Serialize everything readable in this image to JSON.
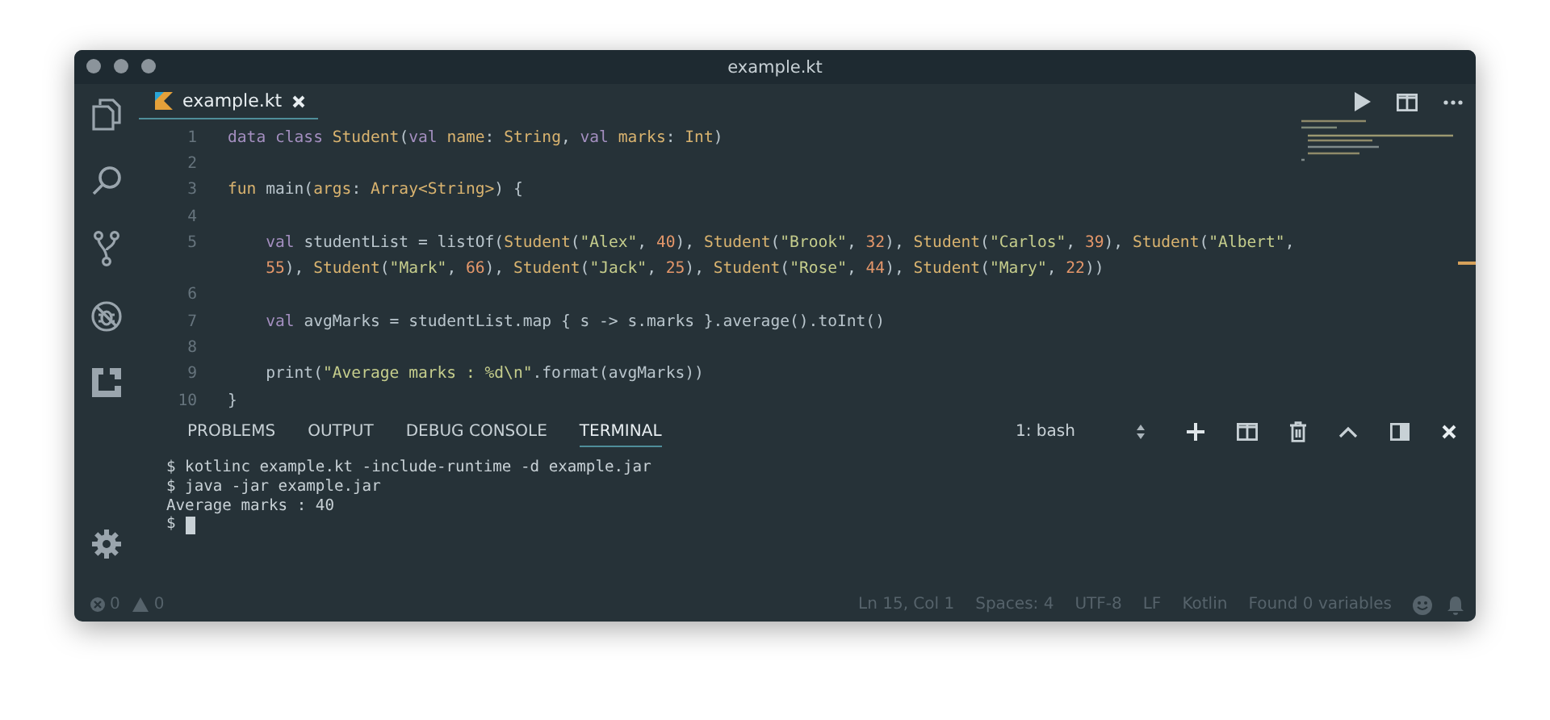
{
  "window": {
    "title": "example.kt"
  },
  "editor_tabs": [
    {
      "label": "example.kt",
      "selected": true
    }
  ],
  "code_lines": [
    {
      "number": "1",
      "tokens": [
        {
          "kind": "kw",
          "text": "data class "
        },
        {
          "kind": "type",
          "text": "Student"
        },
        {
          "kind": "plain",
          "text": "("
        },
        {
          "kind": "kw",
          "text": "val "
        },
        {
          "kind": "type",
          "text": "name"
        },
        {
          "kind": "plain",
          "text": ": "
        },
        {
          "kind": "type",
          "text": "String"
        },
        {
          "kind": "plain",
          "text": ", "
        },
        {
          "kind": "kw",
          "text": "val "
        },
        {
          "kind": "type",
          "text": "marks"
        },
        {
          "kind": "plain",
          "text": ": "
        },
        {
          "kind": "type",
          "text": "Int"
        },
        {
          "kind": "plain",
          "text": ")"
        }
      ]
    },
    {
      "number": "2"
    },
    {
      "number": "3",
      "tokens": [
        {
          "kind": "type",
          "text": "fun "
        },
        {
          "kind": "plain",
          "text": "main("
        },
        {
          "kind": "type",
          "text": "args"
        },
        {
          "kind": "plain",
          "text": ": "
        },
        {
          "kind": "type",
          "text": "Array<String>"
        },
        {
          "kind": "plain",
          "text": ") {"
        }
      ]
    },
    {
      "number": "4"
    },
    {
      "number": "5",
      "tokens": [
        {
          "kind": "kw",
          "text": "    val "
        },
        {
          "kind": "plain",
          "text": "studentList = listOf("
        },
        {
          "kind": "type",
          "text": "Student"
        },
        {
          "kind": "plain",
          "text": "("
        },
        {
          "kind": "str",
          "text": "\"Alex\""
        },
        {
          "kind": "plain",
          "text": ", "
        },
        {
          "kind": "num",
          "text": "40"
        },
        {
          "kind": "plain",
          "text": "), "
        },
        {
          "kind": "type",
          "text": "Student"
        },
        {
          "kind": "plain",
          "text": "("
        },
        {
          "kind": "str",
          "text": "\"Brook\""
        },
        {
          "kind": "plain",
          "text": ", "
        },
        {
          "kind": "num",
          "text": "32"
        },
        {
          "kind": "plain",
          "text": "), "
        },
        {
          "kind": "type",
          "text": "Student"
        },
        {
          "kind": "plain",
          "text": "("
        },
        {
          "kind": "str",
          "text": "\"Carlos\""
        },
        {
          "kind": "plain",
          "text": ", "
        },
        {
          "kind": "num",
          "text": "39"
        },
        {
          "kind": "plain",
          "text": "), "
        },
        {
          "kind": "type",
          "text": "Student"
        },
        {
          "kind": "plain",
          "text": "("
        },
        {
          "kind": "str",
          "text": "\"Albert\""
        },
        {
          "kind": "plain",
          "text": ","
        }
      ]
    },
    {
      "tokens": [
        {
          "kind": "num",
          "text": "    55"
        },
        {
          "kind": "plain",
          "text": "), "
        },
        {
          "kind": "type",
          "text": "Student"
        },
        {
          "kind": "plain",
          "text": "("
        },
        {
          "kind": "str",
          "text": "\"Mark\""
        },
        {
          "kind": "plain",
          "text": ", "
        },
        {
          "kind": "num",
          "text": "66"
        },
        {
          "kind": "plain",
          "text": "), "
        },
        {
          "kind": "type",
          "text": "Student"
        },
        {
          "kind": "plain",
          "text": "("
        },
        {
          "kind": "str",
          "text": "\"Jack\""
        },
        {
          "kind": "plain",
          "text": ", "
        },
        {
          "kind": "num",
          "text": "25"
        },
        {
          "kind": "plain",
          "text": "), "
        },
        {
          "kind": "type",
          "text": "Student"
        },
        {
          "kind": "plain",
          "text": "("
        },
        {
          "kind": "str",
          "text": "\"Rose\""
        },
        {
          "kind": "plain",
          "text": ", "
        },
        {
          "kind": "num",
          "text": "44"
        },
        {
          "kind": "plain",
          "text": "), "
        },
        {
          "kind": "type",
          "text": "Student"
        },
        {
          "kind": "plain",
          "text": "("
        },
        {
          "kind": "str",
          "text": "\"Mary\""
        },
        {
          "kind": "plain",
          "text": ", "
        },
        {
          "kind": "num",
          "text": "22"
        },
        {
          "kind": "plain",
          "text": "))"
        }
      ]
    },
    {
      "number": "6"
    },
    {
      "number": "7",
      "tokens": [
        {
          "kind": "kw",
          "text": "    val "
        },
        {
          "kind": "plain",
          "text": "avgMarks = studentList.map { s -> s.marks }.average().toInt()"
        }
      ]
    },
    {
      "number": "8"
    },
    {
      "number": "9",
      "tokens": [
        {
          "kind": "plain",
          "text": "    print("
        },
        {
          "kind": "str",
          "text": "\"Average marks : %d\\n\""
        },
        {
          "kind": "plain",
          "text": ".format(avgMarks))"
        }
      ]
    },
    {
      "number": "10",
      "tokens": [
        {
          "kind": "plain",
          "text": "}"
        }
      ]
    }
  ],
  "panel": {
    "tabs": [
      {
        "label": "PROBLEMS",
        "selected": false
      },
      {
        "label": "OUTPUT",
        "selected": false
      },
      {
        "label": "DEBUG CONSOLE",
        "selected": false
      },
      {
        "label": "TERMINAL",
        "selected": true
      }
    ],
    "terminal_select": "1: bash",
    "terminal_lines": [
      "$ kotlinc example.kt -include-runtime -d example.jar",
      "$ java -jar example.jar",
      "Average marks : 40"
    ],
    "prompt": "$"
  },
  "status_bar": {
    "errors": "0",
    "warnings": "0",
    "items": [
      "Ln 15, Col 1",
      "Spaces: 4",
      "UTF-8",
      "LF",
      "Kotlin",
      "Found 0 variables"
    ]
  }
}
